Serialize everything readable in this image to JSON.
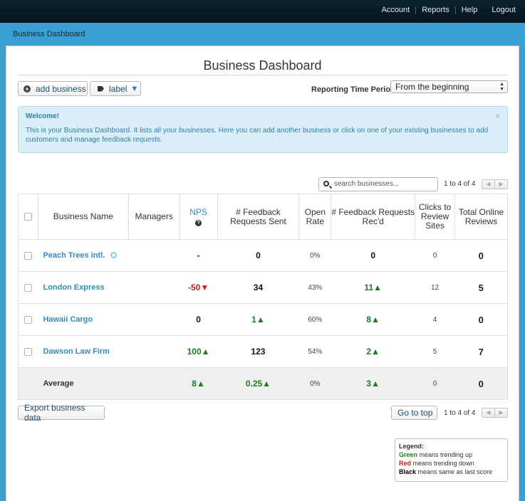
{
  "topnav": {
    "account": "Account",
    "reports": "Reports",
    "help": "Help",
    "logout": "Logout"
  },
  "breadcrumb": "Business Dashboard",
  "page_title": "Business Dashboard",
  "toolbar": {
    "add_business": "add business",
    "label": "label",
    "label_caret": "▼"
  },
  "reporting": {
    "label": "Reporting Time Period",
    "selected": "From the beginning"
  },
  "alert": {
    "title": "Welcome!",
    "body": "This is your Business Dashboard. It lists all your businesses. Here you can add another business or click on one of your existing businesses to add customers and manage feedback requests.",
    "close": "×"
  },
  "search": {
    "placeholder": "search businesses..."
  },
  "pager": {
    "text": "1 to 4 of 4",
    "prev": "◀",
    "next": "▶"
  },
  "table": {
    "headers": {
      "business_name": "Business Name",
      "managers": "Managers",
      "nps": "NPS",
      "nps_help": "?",
      "feedback_sent": "# Feedback Requests Sent",
      "open_rate": "Open Rate",
      "feedback_recd": "# Feedback Requests Rec'd",
      "clicks": "Clicks to Review Sites",
      "total_reviews": "Total Online Reviews"
    },
    "rows": [
      {
        "name": "Peach Trees intl.",
        "managers": "",
        "nps": "-",
        "sent": "0",
        "open_rate": "0%",
        "recd": "0",
        "clicks": "0",
        "reviews": "0"
      },
      {
        "name": "London Express",
        "managers": "",
        "nps": "-50▼",
        "sent": "34",
        "open_rate": "43%",
        "recd": "11▲",
        "clicks": "12",
        "reviews": "5"
      },
      {
        "name": "Hawaii Cargo",
        "managers": "",
        "nps": "0",
        "sent": "1▲",
        "open_rate": "60%",
        "recd": "8▲",
        "clicks": "4",
        "reviews": "0"
      },
      {
        "name": "Dawson Law Firm",
        "managers": "",
        "nps": "100▲",
        "sent": "123",
        "open_rate": "54%",
        "recd": "2▲",
        "clicks": "5",
        "reviews": "7"
      }
    ],
    "average": {
      "name": "Average",
      "nps": "8▲",
      "sent": "0.25▲",
      "open_rate": "0%",
      "recd": "3▲",
      "clicks": "0",
      "reviews": "0"
    }
  },
  "footer": {
    "export": "Export business data",
    "go_top": "Go to top"
  },
  "legend": {
    "title": "Legend:",
    "green_word": "Green",
    "green_text": " means trending up",
    "red_word": "Red",
    "red_text": " means trending down",
    "black_word": "Black",
    "black_text": " means same as last score"
  },
  "colors": {
    "accent": "#3aa0d3",
    "link": "#2f8cbc",
    "up": "#1f7a1f",
    "down": "#d21b1b"
  }
}
